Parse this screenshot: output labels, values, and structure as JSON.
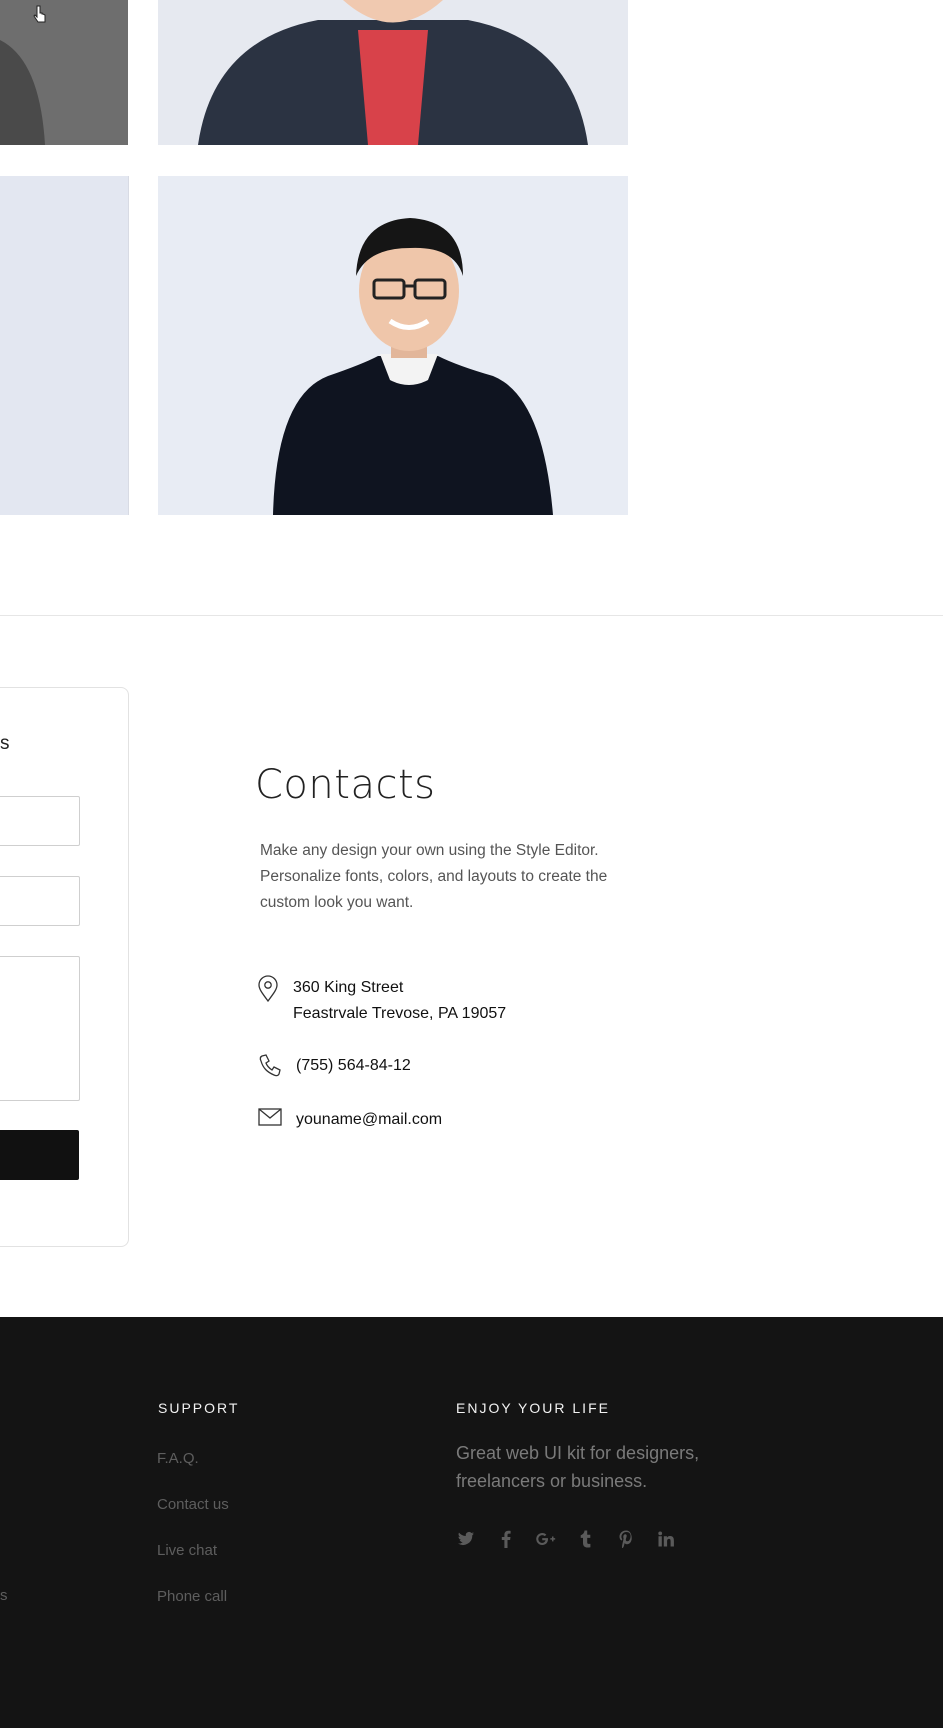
{
  "contacts": {
    "title": "Contacts",
    "description": "Make any design your own using the Style Editor. Personalize fonts, colors, and layouts to create the custom look you want.",
    "address_line1": "360 King Street",
    "address_line2": "Feastrvale Trevose, PA 19057",
    "phone": "(755) 564-84-12",
    "email": "youname@mail.com"
  },
  "form": {
    "heading_fragment": "s"
  },
  "footer": {
    "support_heading": "SUPPORT",
    "support_links": [
      "F.A.Q.",
      "Contact us",
      "Live chat",
      "Phone call"
    ],
    "cut_link_fragment": "s",
    "enjoy_heading": "ENJOY YOUR LIFE",
    "tagline": "Great web UI kit for designers, freelancers or business.",
    "socials": [
      "twitter-icon",
      "facebook-icon",
      "google-plus-icon",
      "tumblr-icon",
      "pinterest-icon",
      "linkedin-icon"
    ]
  },
  "colors": {
    "footer_bg": "#141414",
    "footer_link": "#5e5e5e",
    "footer_heading": "#f2f2f2",
    "text_dark": "#111111",
    "text_muted": "#555555"
  }
}
